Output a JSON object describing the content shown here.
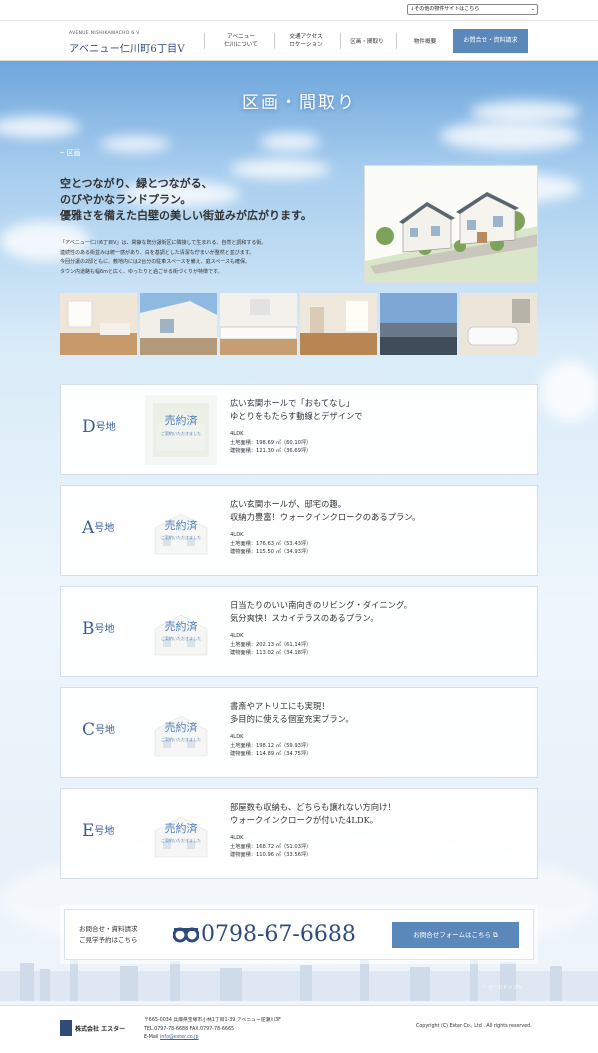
{
  "topbar": {
    "site_select": "↓その他の物件サイトはこちら"
  },
  "header": {
    "logo_sub": "AVENUE NISHIKAWACHO 6 Ⅴ",
    "logo_main": "アベニュー仁川町6丁目Ⅴ",
    "nav": [
      {
        "line1": "アベニュー",
        "line2": "仁川について"
      },
      {
        "line1": "交通アクセス",
        "line2": "ロケーション"
      },
      {
        "line1": "区画・間取り",
        "line2": ""
      },
      {
        "line1": "物件概要",
        "line2": ""
      }
    ],
    "cta": "お問合せ・資料請求"
  },
  "page_title": "区画・間取り",
  "section_tag": "─ 区画",
  "headline": [
    "空とつながり、緑とつながる、",
    "のびやかなランドプラン。",
    "優雅さを備えた白壁の美しい街並みが広がります。"
  ],
  "body": [
    "「アベニュー仁川6丁目Ⅴ」は、閑静な既分譲街区に隣接して生まれる、自然と調和する街。",
    "連続性のある街並みは統一感があり、白を基調とした清潔な佇まいが整然と並びます。",
    "今回分譲の2邸ともに、敷地内には2台分の駐車スペースを備え、庭スペースも確保。",
    "タウン内道路も幅6mと広く、ゆったりと過ごせる街づくりが特徴です。"
  ],
  "thumbs": [
    "living-photo",
    "exterior-photo",
    "kitchen-photo",
    "interior-photo",
    "view-photo",
    "bathroom-photo"
  ],
  "lots": [
    {
      "letter": "D",
      "suffix": "号地",
      "sold": "売約済",
      "sold_sub": "ご契約いただきました",
      "title1": "広い玄関ホールで「おもてなし」",
      "title2": "ゆとりをもたらす動線とデザインで",
      "type": "4LDK",
      "land": "土地面積：198.69 ㎡（60.10坪）",
      "building": "建物面積：121.30 ㎡（36.69坪）"
    },
    {
      "letter": "A",
      "suffix": "号地",
      "sold": "売約済",
      "sold_sub": "ご契約いただきました",
      "title1": "広い玄関ホールが、邸宅の趣。",
      "title2": "収納力豊富！ウォークインクロークのあるプラン。",
      "type": "4LDK",
      "land": "土地面積：176.63 ㎡（53.43坪）",
      "building": "建物面積：115.50 ㎡（34.93坪）"
    },
    {
      "letter": "B",
      "suffix": "号地",
      "sold": "売約済",
      "sold_sub": "ご契約いただきました",
      "title1": "日当たりのいい南向きのリビング・ダイニング。",
      "title2": "気分爽快！スカイテラスのあるプラン。",
      "type": "4LDK",
      "land": "土地面積：202.13 ㎡（61.14坪）",
      "building": "建物面積：113.02 ㎡（34.18坪）"
    },
    {
      "letter": "C",
      "suffix": "号地",
      "sold": "売約済",
      "sold_sub": "ご契約いただきました",
      "title1": "書斎やアトリエにも実現！",
      "title2": "多目的に使える個室充実プラン。",
      "type": "4LDK",
      "land": "土地面積：198.12 ㎡（59.93坪）",
      "building": "建物面積：114.89 ㎡（34.75坪）"
    },
    {
      "letter": "E",
      "suffix": "号地",
      "sold": "売約済",
      "sold_sub": "ご契約いただきました",
      "title1": "部屋数も収納も、どちらも譲れない方向け！",
      "title2": "ウォークインクロークが付いた4LDK。",
      "type": "4LDK",
      "land": "土地面積：168.72 ㎡（51.03坪）",
      "building": "建物面積：110.96 ㎡（33.56坪）"
    }
  ],
  "contact": {
    "line1": "お問合せ・資料請求",
    "line2": "ご見学予約はこちら",
    "phone": "0798-67-6688",
    "button": "お問合せフォームはこちら ⧉"
  },
  "pagetop": "⌃ ページトップへ",
  "footer": {
    "company": "株式会社 エスター",
    "address": "〒665-0034 兵庫県宝塚市小林1丁目1-39 アベニュー逆瀬川3F",
    "tel": "TEL.0797-78-6688 FAX.0797-78-6665",
    "mail_label": "E-Mail ",
    "mail": "info@ester.co.jp",
    "copyright": "Copyright (C) Ester Co., Ltd . All rights reserved."
  },
  "colors": {
    "accent": "#5b88ba",
    "navy": "#2f4b7a",
    "sky_top": "#6ea6dc",
    "sold_stamp": "#4f7fb8"
  }
}
